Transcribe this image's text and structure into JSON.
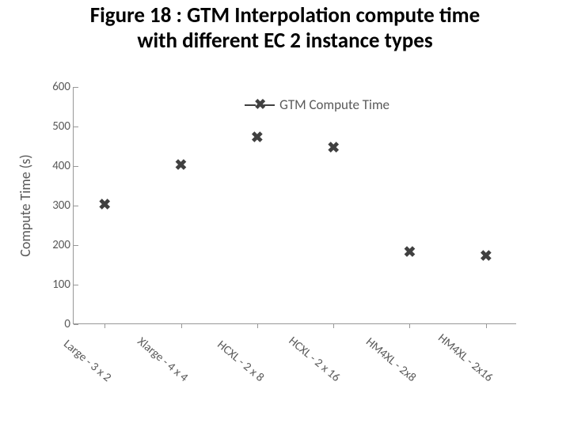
{
  "title": "Figure 18 : GTM Interpolation compute time\nwith different EC 2 instance types",
  "chart_data": {
    "type": "line",
    "title": "Figure 18 : GTM Interpolation compute time with different EC2 instance types",
    "xlabel": "",
    "ylabel": "Compute Time (s)",
    "ylim": [
      0,
      600
    ],
    "yticks": [
      0,
      100,
      200,
      300,
      400,
      500,
      600
    ],
    "categories": [
      "Large - 3 x 2",
      "Xlarge - 4 x 4",
      "HCXL - 2 x 8",
      "HCXL - 2 x 16",
      "HM4XL - 2x8",
      "HM4XL - 2x16"
    ],
    "series": [
      {
        "name": "GTM Compute Time",
        "values": [
          300,
          400,
          470,
          445,
          180,
          170
        ],
        "marker": "x",
        "color": "#404040"
      }
    ]
  }
}
